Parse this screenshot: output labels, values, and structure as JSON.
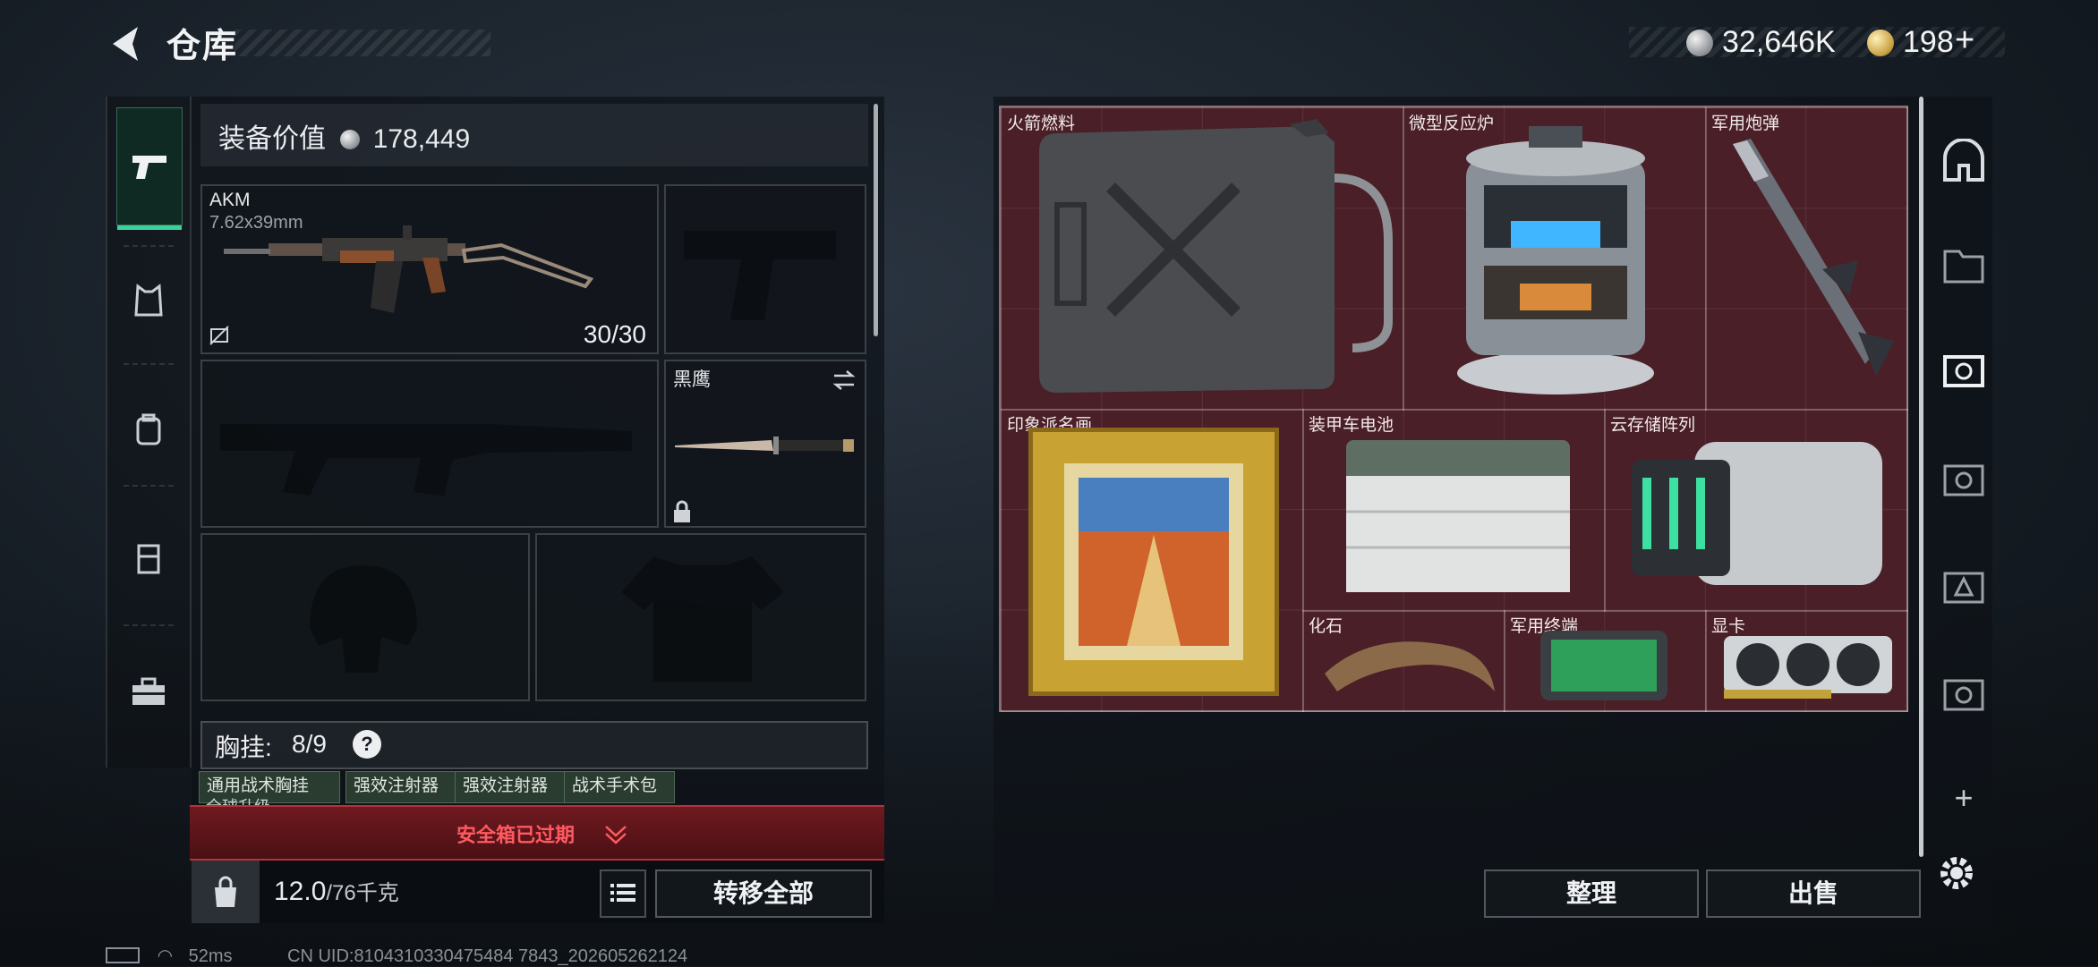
{
  "header": {
    "title": "仓库",
    "currency_silver": "32,646K",
    "currency_gold": "198",
    "add_symbol": "+"
  },
  "loadout": {
    "value_label": "装备价值",
    "value": "178,449",
    "primary_weapon": {
      "name": "AKM",
      "ammo_type": "7.62x39mm",
      "ammo": "30/30"
    },
    "melee": {
      "name": "黑鹰"
    },
    "chest_rig": {
      "label": "胸挂:",
      "capacity": "8/9",
      "help": "?"
    },
    "rig_items": [
      "通用战术胸挂",
      "强效注射器",
      "强效注射器",
      "战术手术包"
    ],
    "rig_item_sub": "全球升级",
    "safebox_status": "安全箱已过期",
    "weight_value": "12.0",
    "weight_max": "/76千克",
    "transfer_all": "转移全部"
  },
  "stash": {
    "items": [
      {
        "label": "火箭燃料"
      },
      {
        "label": "微型反应炉"
      },
      {
        "label": "军用炮弹"
      },
      {
        "label": "印象派名画"
      },
      {
        "label": "装甲车电池"
      },
      {
        "label": "云存储阵列"
      },
      {
        "label": "化石"
      },
      {
        "label": "军用终端"
      },
      {
        "label": "显卡"
      }
    ],
    "sort_button": "整理",
    "sell_button": "出售",
    "add_tab": "+"
  },
  "status_bar": {
    "ping": "52ms",
    "uid": "CN UID:8104310330475484 7843_202605262124"
  },
  "colors": {
    "stash_bg": "#4a1f27",
    "accent_green": "#37d39a",
    "alert_red": "#ff5a5f"
  }
}
